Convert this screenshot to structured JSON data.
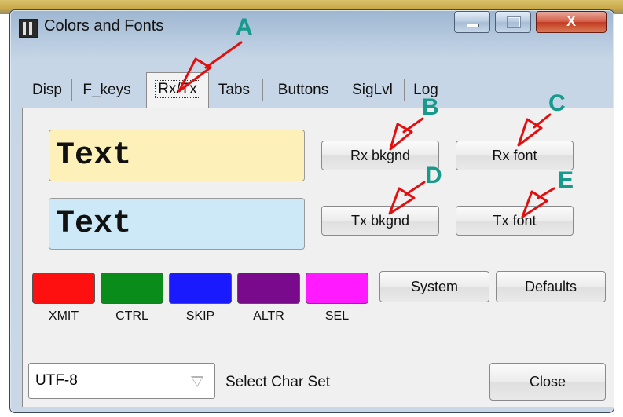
{
  "window": {
    "title": "Colors and Fonts",
    "controls": {
      "minimize": "minimize",
      "maximize": "maximize",
      "close": "X"
    }
  },
  "tabs": [
    "Disp",
    "F_keys",
    "Rx/Tx",
    "Tabs",
    "Buttons",
    "SigLvl",
    "Log"
  ],
  "selected_tab": "Rx/Tx",
  "samples": {
    "rx": {
      "text": "Text",
      "background": "#fdf0b8"
    },
    "tx": {
      "text": "Text",
      "background": "#cde9f8"
    }
  },
  "buttons": {
    "rx_bkgnd": "Rx bkgnd",
    "rx_font": "Rx font",
    "tx_bkgnd": "Tx bkgnd",
    "tx_font": "Tx font",
    "system": "System",
    "defaults": "Defaults",
    "close": "Close"
  },
  "swatches": [
    {
      "label": "XMIT",
      "color": "#ff1010"
    },
    {
      "label": "CTRL",
      "color": "#0a8c1a"
    },
    {
      "label": "SKIP",
      "color": "#1a1aff"
    },
    {
      "label": "ALTR",
      "color": "#7a0a8c"
    },
    {
      "label": "SEL",
      "color": "#ff1aff"
    }
  ],
  "charset": {
    "value": "UTF-8",
    "label": "Select Char Set"
  },
  "annotations": [
    "A",
    "B",
    "C",
    "D",
    "E"
  ],
  "annotation_color": "#159a8c",
  "arrow_color": "#e01010"
}
